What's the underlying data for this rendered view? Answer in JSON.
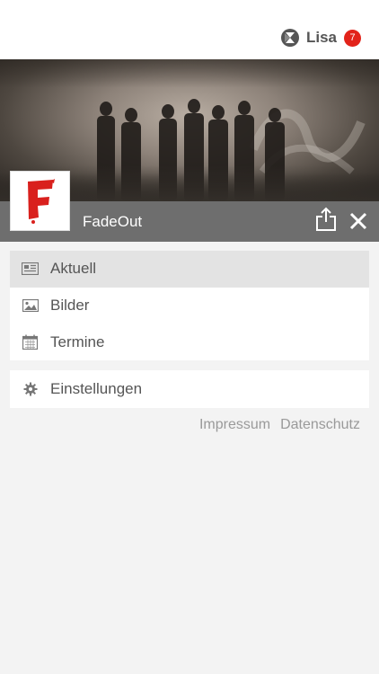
{
  "header": {
    "user_name": "Lisa",
    "notification_count": "7",
    "logo_icon": "brand-logo-icon"
  },
  "band": {
    "name": "FadeOut",
    "logo_letter": "F",
    "logo_color": "#d9201d",
    "share_icon": "share-icon",
    "close_icon": "close-icon"
  },
  "menu": {
    "items": [
      {
        "label": "Aktuell",
        "icon": "newspaper-icon",
        "active": true
      },
      {
        "label": "Bilder",
        "icon": "image-icon",
        "active": false
      },
      {
        "label": "Termine",
        "icon": "calendar-icon",
        "active": false
      }
    ]
  },
  "settings_menu": {
    "items": [
      {
        "label": "Einstellungen",
        "icon": "gear-icon"
      }
    ]
  },
  "footer": {
    "impressum": "Impressum",
    "datenschutz": "Datenschutz"
  },
  "colors": {
    "accent_red": "#e2231a",
    "bar_gray": "#6e6e6e",
    "background": "#f3f3f3"
  }
}
